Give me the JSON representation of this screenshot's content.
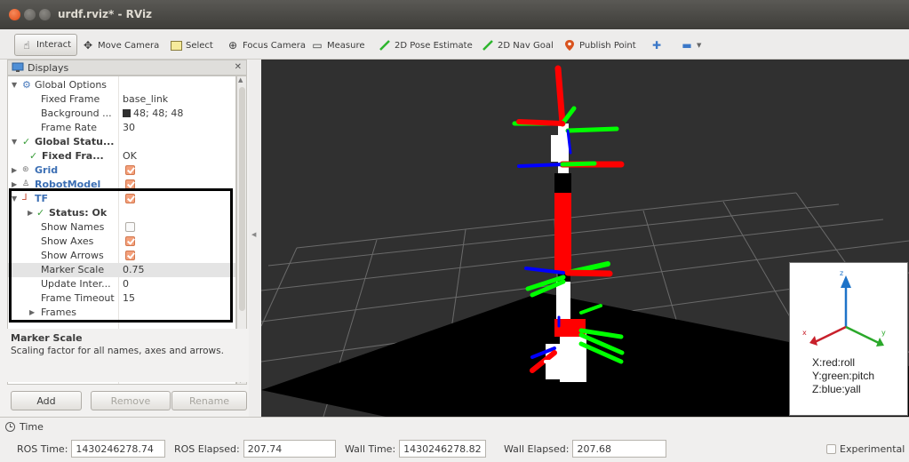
{
  "window": {
    "title": "urdf.rviz* - RViz"
  },
  "toolbar": {
    "interact": "Interact",
    "move_camera": "Move Camera",
    "select": "Select",
    "focus_camera": "Focus Camera",
    "measure": "Measure",
    "pose_estimate": "2D Pose Estimate",
    "nav_goal": "2D Nav Goal",
    "publish_point": "Publish Point"
  },
  "displays": {
    "title": "Displays",
    "rows": {
      "global_options": "Global Options",
      "fixed_frame": {
        "label": "Fixed Frame",
        "value": "base_link"
      },
      "background": {
        "label": "Background ...",
        "value": "48; 48; 48"
      },
      "frame_rate": {
        "label": "Frame Rate",
        "value": "30"
      },
      "global_status": "Global Statu...",
      "fixed_frame_status": {
        "label": "Fixed Fra...",
        "value": "OK"
      },
      "grid": "Grid",
      "robot_model": "RobotModel",
      "tf": "TF",
      "status_ok": "Status: Ok",
      "show_names": "Show Names",
      "show_axes": "Show Axes",
      "show_arrows": "Show Arrows",
      "marker_scale": {
        "label": "Marker Scale",
        "value": "0.75"
      },
      "update_interval": {
        "label": "Update Inter...",
        "value": "0"
      },
      "frame_timeout": {
        "label": "Frame Timeout",
        "value": "15"
      },
      "frames": "Frames"
    },
    "checks": {
      "grid": true,
      "robot_model": true,
      "tf": true,
      "show_names": false,
      "show_axes": true,
      "show_arrows": true
    },
    "background_color": "#303030",
    "description": {
      "title": "Marker Scale",
      "text": "Scaling factor for all names, axes and arrows."
    },
    "buttons": {
      "add": "Add",
      "remove": "Remove",
      "rename": "Rename"
    }
  },
  "axes_legend": {
    "x_label": "X:red:roll",
    "y_label": "Y:green:pitch",
    "z_label": "Z:blue:yall",
    "axis_x": "x",
    "axis_y": "y",
    "axis_z": "z"
  },
  "time": {
    "title": "Time",
    "ros_time_label": "ROS Time:",
    "ros_time": "1430246278.74",
    "ros_elapsed_label": "ROS Elapsed:",
    "ros_elapsed": "207.74",
    "wall_time_label": "Wall Time:",
    "wall_time": "1430246278.82",
    "wall_elapsed_label": "Wall Elapsed:",
    "wall_elapsed": "207.68",
    "experimental": "Experimental"
  },
  "colors": {
    "accent": "#dd4814",
    "axis_red": "#ff0000",
    "axis_green": "#00ff00",
    "axis_blue": "#0000ff",
    "link_red": "#ff0000"
  }
}
